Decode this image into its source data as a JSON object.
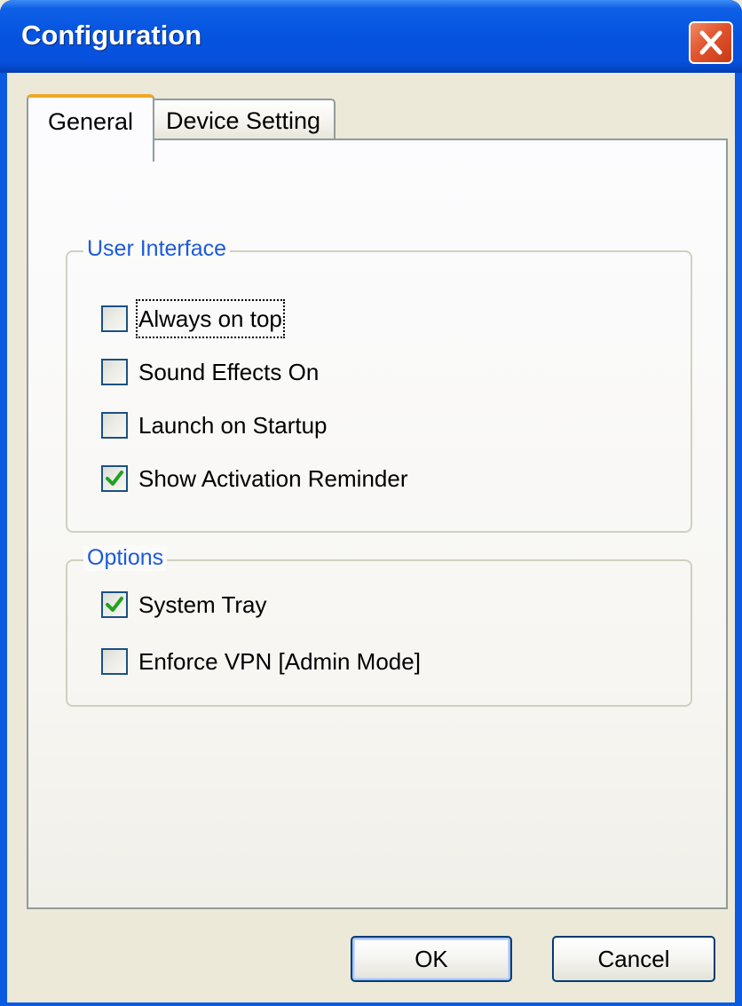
{
  "window": {
    "title": "Configuration",
    "close_icon": "close-icon"
  },
  "tabs": [
    {
      "label": "General",
      "selected": true
    },
    {
      "label": "Device Setting",
      "selected": false
    }
  ],
  "groups": {
    "user_interface": {
      "legend": "User Interface",
      "items": [
        {
          "label": "Always on top",
          "checked": false,
          "focused": true
        },
        {
          "label": "Sound Effects On",
          "checked": false
        },
        {
          "label": "Launch on Startup",
          "checked": false
        },
        {
          "label": "Show Activation Reminder",
          "checked": true
        }
      ]
    },
    "options": {
      "legend": "Options",
      "items": [
        {
          "label": "System Tray",
          "checked": true
        },
        {
          "label": "Enforce VPN [Admin Mode]",
          "checked": false
        }
      ]
    }
  },
  "buttons": {
    "ok": "OK",
    "cancel": "Cancel"
  },
  "colors": {
    "titlebar": "#0553e0",
    "close": "#e2542e",
    "legend_text": "#1c5adc",
    "tab_highlight": "#f0a72c",
    "checkmark": "#21a121",
    "face": "#ece9d8"
  }
}
